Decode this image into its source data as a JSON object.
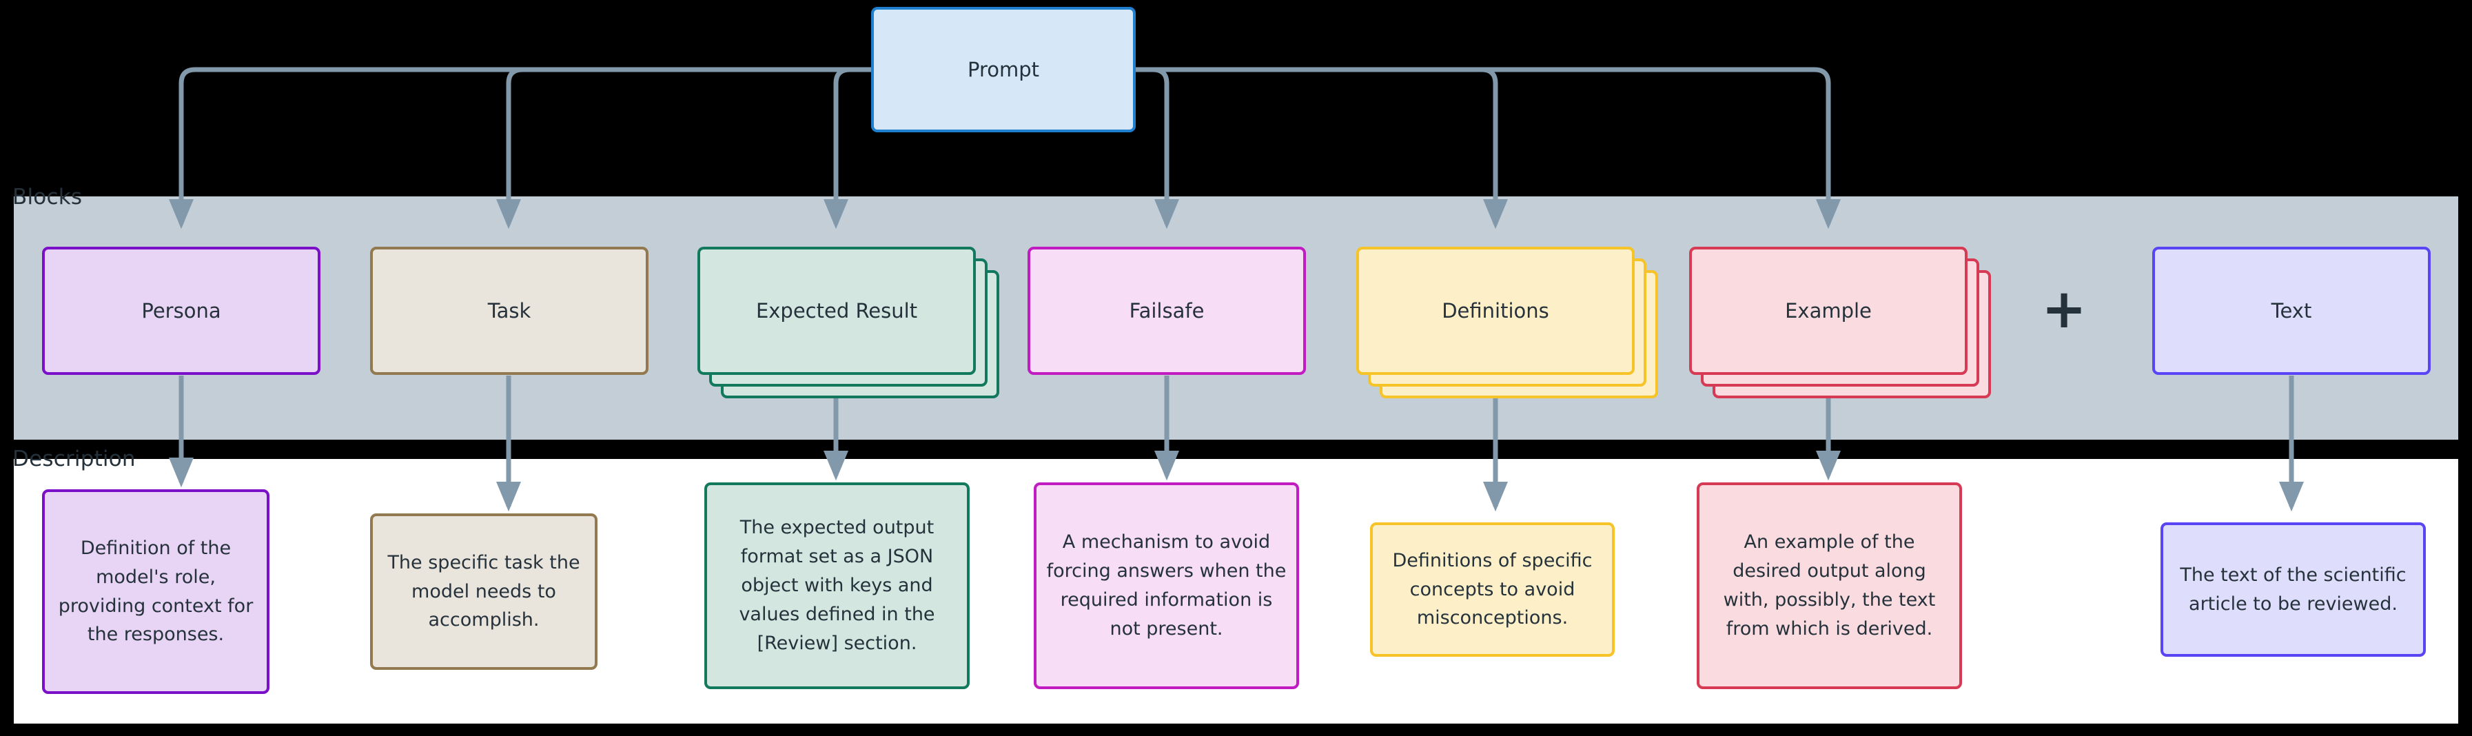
{
  "diagram": {
    "root": {
      "label": "Prompt",
      "fill": "#d6e8f8",
      "stroke": "#1f80d0"
    },
    "lanes": {
      "blocks_label": "Blocks",
      "description_label": "Description",
      "blocks_band_color": "#c3ced6",
      "description_band_color": "#ffffff"
    },
    "plus_symbol": "+",
    "connector_color": "#8299ab",
    "columns": [
      {
        "id": "persona",
        "block_label": "Persona",
        "description": "Definition of the model's role, providing context for the responses.",
        "fill": "#e8d4f5",
        "stroke": "#7a11c9",
        "stacked": false,
        "stack_count": 1
      },
      {
        "id": "task",
        "block_label": "Task",
        "description": "The specific task the model needs to accomplish.",
        "fill": "#e9e4dc",
        "stroke": "#93794f",
        "stacked": false,
        "stack_count": 1
      },
      {
        "id": "expected-result",
        "block_label": "Expected Result",
        "description": "The expected output format set as a JSON object with keys and values defined in the [Review] section.",
        "fill": "#d4e6e0",
        "stroke": "#12795c",
        "stacked": true,
        "stack_count": 3
      },
      {
        "id": "failsafe",
        "block_label": "Failsafe",
        "description": "A mechanism to avoid forcing answers when the required information is not present.",
        "fill": "#f7ddf6",
        "stroke": "#c11cc1",
        "stacked": false,
        "stack_count": 1
      },
      {
        "id": "definitions",
        "block_label": "Definitions",
        "description": "Definitions of specific concepts to avoid misconceptions.",
        "fill": "#fdf0c8",
        "stroke": "#f6c328",
        "stacked": true,
        "stack_count": 3
      },
      {
        "id": "example",
        "block_label": "Example",
        "description": "An example of the desired output along with, possibly, the text from which is derived.",
        "fill": "#fadce0",
        "stroke": "#d63a54",
        "stacked": true,
        "stack_count": 3
      },
      {
        "id": "text",
        "block_label": "Text",
        "description": "The text of the scientific article to be reviewed.",
        "fill": "#deddfb",
        "stroke": "#5a45f5",
        "stacked": false,
        "stack_count": 1
      }
    ]
  }
}
